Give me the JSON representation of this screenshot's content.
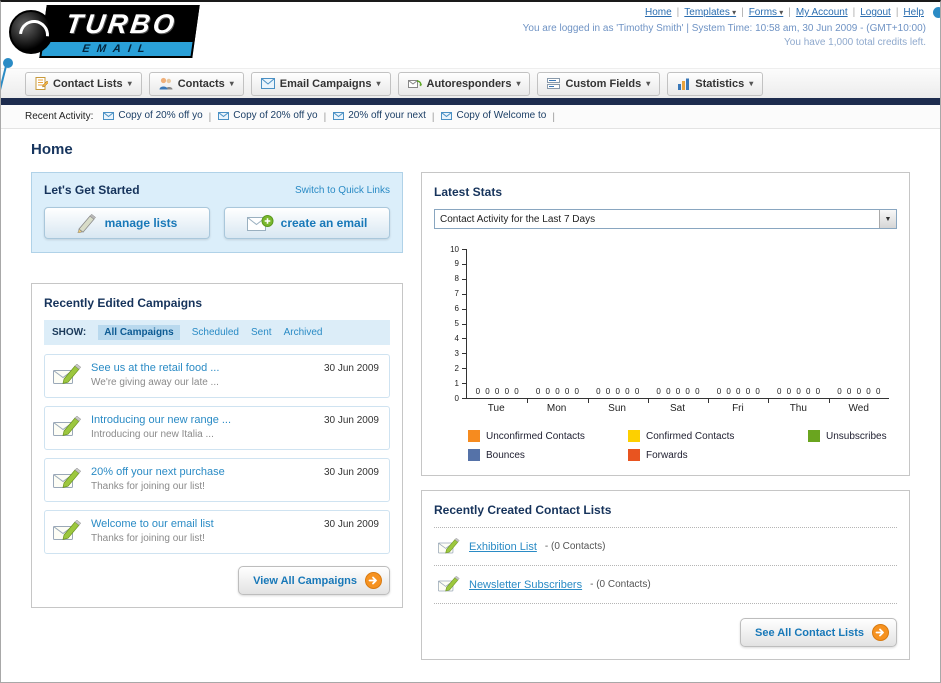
{
  "colors": {
    "accent_blue": "#2a8bc5",
    "navy_bar": "#1d2c4e",
    "arrow_orange": "#f69220",
    "panel_blue": "#dbeefa"
  },
  "header": {
    "logo_primary": "TURBO",
    "logo_secondary": "EMAIL",
    "top_links": [
      {
        "label": "Home",
        "dropdown": false
      },
      {
        "label": "Templates",
        "dropdown": true
      },
      {
        "label": "Forms",
        "dropdown": true
      },
      {
        "label": "My Account",
        "dropdown": false
      },
      {
        "label": "Logout",
        "dropdown": false
      },
      {
        "label": "Help",
        "dropdown": false
      }
    ],
    "login_info": "You are logged in as 'Timothy Smith' | System Time: 10:58 am, 30 Jun 2009 - (GMT+10:00)",
    "credits_info": "You have 1,000 total credits left."
  },
  "nav_tabs": [
    {
      "label": "Contact Lists",
      "icon": "contact-lists-icon"
    },
    {
      "label": "Contacts",
      "icon": "contacts-icon"
    },
    {
      "label": "Email Campaigns",
      "icon": "email-campaigns-icon"
    },
    {
      "label": "Autoresponders",
      "icon": "autoresponders-icon"
    },
    {
      "label": "Custom Fields",
      "icon": "custom-fields-icon"
    },
    {
      "label": "Statistics",
      "icon": "statistics-icon"
    }
  ],
  "recent_activity": {
    "label": "Recent Activity:",
    "items": [
      "Copy of 20% off yo",
      "Copy of 20% off yo",
      "20% off your next",
      "Copy of Welcome to"
    ]
  },
  "page_title": "Home",
  "get_started": {
    "title": "Let's Get Started",
    "switch_link": "Switch to Quick Links",
    "buttons": [
      {
        "label": "manage lists",
        "icon": "pencil-icon"
      },
      {
        "label": "create an email",
        "icon": "envelope-plus-icon"
      }
    ]
  },
  "campaigns": {
    "title": "Recently Edited Campaigns",
    "show_label": "SHOW:",
    "filters": [
      {
        "label": "All Campaigns",
        "active": true
      },
      {
        "label": "Scheduled",
        "active": false
      },
      {
        "label": "Sent",
        "active": false
      },
      {
        "label": "Archived",
        "active": false
      }
    ],
    "items": [
      {
        "title": "See us at the retail food ...",
        "subtitle": "We're giving away our late ...",
        "date": "30 Jun 2009"
      },
      {
        "title": "Introducing our new range ...",
        "subtitle": "Introducing our new Italia ...",
        "date": "30 Jun 2009"
      },
      {
        "title": "20% off your next purchase",
        "subtitle": "Thanks for joining our list!",
        "date": "30 Jun 2009"
      },
      {
        "title": "Welcome to our email list",
        "subtitle": "Thanks for joining our list!",
        "date": "30 Jun 2009"
      }
    ],
    "view_all_label": "View All Campaigns"
  },
  "stats": {
    "title": "Latest Stats",
    "period_selector": "Contact Activity for the Last 7 Days",
    "chart_data": {
      "type": "bar",
      "title": "Contact Activity for the Last 7 Days",
      "categories": [
        "Tue",
        "Mon",
        "Sun",
        "Sat",
        "Fri",
        "Thu",
        "Wed"
      ],
      "series": [
        {
          "name": "Unconfirmed Contacts",
          "color": "#f68b1f",
          "values": [
            0,
            0,
            0,
            0,
            0,
            0,
            0
          ]
        },
        {
          "name": "Confirmed Contacts",
          "color": "#fdd000",
          "values": [
            0,
            0,
            0,
            0,
            0,
            0,
            0
          ]
        },
        {
          "name": "Unsubscribes",
          "color": "#6aa51f",
          "values": [
            0,
            0,
            0,
            0,
            0,
            0,
            0
          ]
        },
        {
          "name": "Bounces",
          "color": "#5572a8",
          "values": [
            0,
            0,
            0,
            0,
            0,
            0,
            0
          ]
        },
        {
          "name": "Forwards",
          "color": "#e85420",
          "values": [
            0,
            0,
            0,
            0,
            0,
            0,
            0
          ]
        }
      ],
      "ylim": [
        0,
        10
      ],
      "y_ticks": [
        0,
        1,
        2,
        3,
        4,
        5,
        6,
        7,
        8,
        9,
        10
      ],
      "grid": false,
      "legend_position": "bottom",
      "show_value_labels": true
    }
  },
  "contact_lists": {
    "title": "Recently Created Contact Lists",
    "items": [
      {
        "name": "Exhibition List",
        "detail": "- (0 Contacts)"
      },
      {
        "name": "Newsletter Subscribers",
        "detail": "- (0 Contacts)"
      }
    ],
    "see_all_label": "See All Contact Lists"
  }
}
